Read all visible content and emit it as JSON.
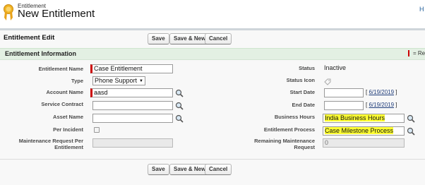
{
  "header": {
    "subtitle": "Entitlement",
    "title": "New Entitlement",
    "help_text": "H"
  },
  "edit": {
    "title": "Entitlement Edit",
    "save_label": "Save",
    "save_new_label": "Save & New",
    "cancel_label": "Cancel"
  },
  "section": {
    "title": "Entitlement Information",
    "required_legend": "= Re"
  },
  "left": {
    "entitlement_name": {
      "label": "Entitlement Name",
      "value": "Case Entitlement"
    },
    "type": {
      "label": "Type",
      "value": "Phone Support"
    },
    "account_name": {
      "label": "Account Name",
      "value": "aasd"
    },
    "service_contract": {
      "label": "Service Contract",
      "value": ""
    },
    "asset_name": {
      "label": "Asset Name",
      "value": ""
    },
    "per_incident": {
      "label": "Per Incident",
      "checked": false
    },
    "maintenance_request_per_entitlement": {
      "label": "Maintenance Request Per Entitlement",
      "value": ""
    }
  },
  "right": {
    "status": {
      "label": "Status",
      "value": "Inactive"
    },
    "status_icon": {
      "label": "Status Icon"
    },
    "start_date": {
      "label": "Start Date",
      "value": "",
      "today_link": "6/19/2019"
    },
    "end_date": {
      "label": "End Date",
      "value": "",
      "today_link": "6/19/2019"
    },
    "business_hours": {
      "label": "Business Hours",
      "value": "India Business Hours"
    },
    "entitlement_process": {
      "label": "Entitlement Process",
      "value": "Case Milestone Process"
    },
    "remaining_maintenance_request": {
      "label": "Remaining Maintenance Request",
      "value": "0"
    }
  },
  "colors": {
    "required": "#cc0000",
    "section_bar": "#e3f0e3",
    "highlight": "#ffff33"
  }
}
